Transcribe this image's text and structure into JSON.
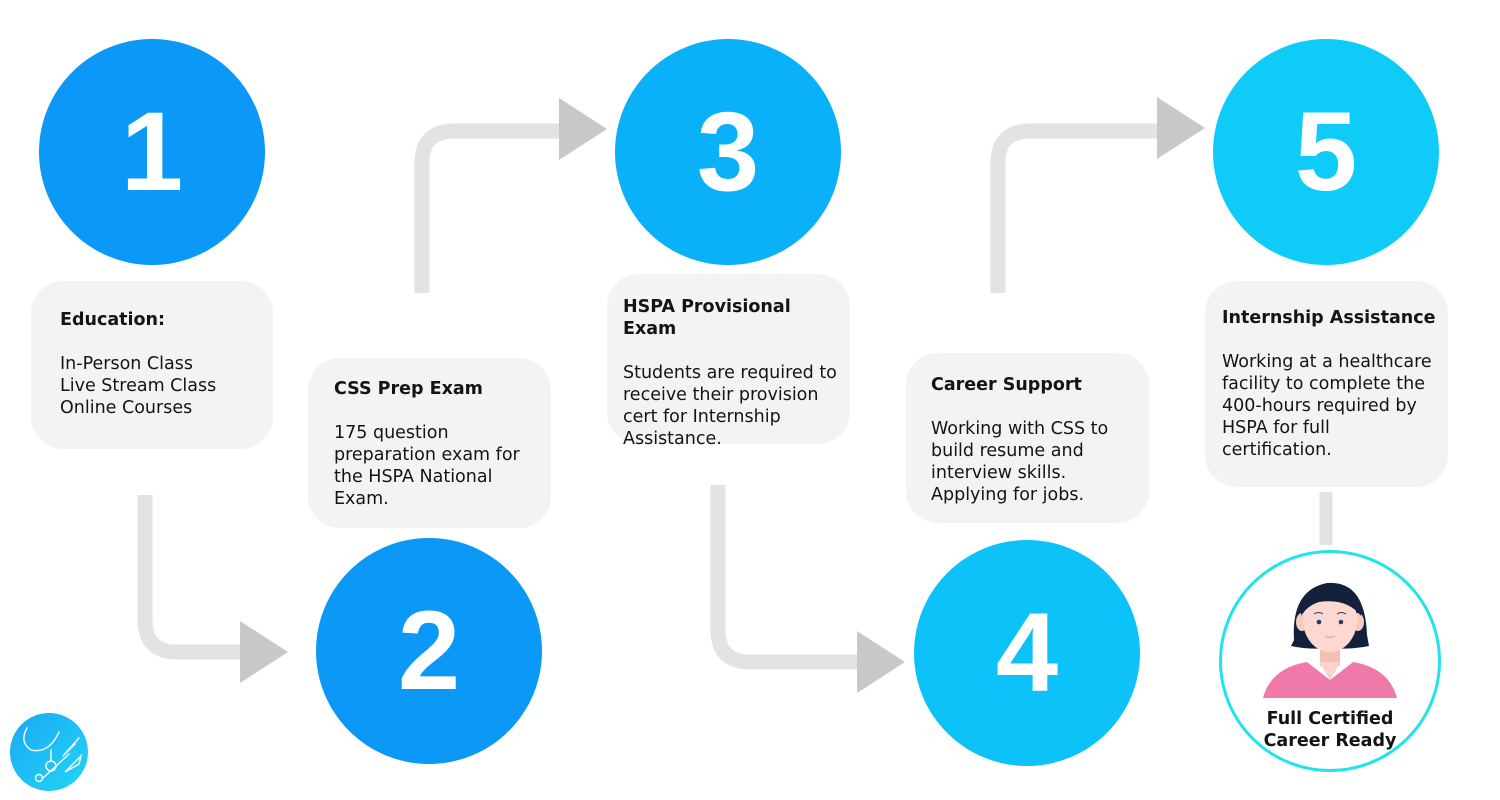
{
  "theme": {
    "circle_colors": [
      "#0b98f7",
      "#0b98f7",
      "#0ab1f9",
      "#0dc2f9",
      "#0fcbf7"
    ],
    "card_background": "#f3f3f3",
    "connector_color": "#e3e3e3",
    "arrowhead_color": "#c8c8c8",
    "final_ring_color": "#22e3ea"
  },
  "steps": [
    {
      "number": "1",
      "title": "Education:",
      "body": "In-Person Class\nLive Stream Class\nOnline Courses"
    },
    {
      "number": "2",
      "title": "CSS Prep Exam",
      "body": "175 question\npreparation exam for\nthe HSPA National\nExam."
    },
    {
      "number": "3",
      "title": "HSPA Provisional Exam",
      "body": "Students are required to\nreceive their provision\ncert for Internship\nAssistance."
    },
    {
      "number": "4",
      "title": "Career Support",
      "body": "Working with CSS to\nbuild resume and\ninterview skills.\nApplying for jobs."
    },
    {
      "number": "5",
      "title": "Internship Assistance",
      "body": "Working at a healthcare\nfacility to complete the\n400-hours required by\nHSPA for full\ncertification."
    }
  ],
  "final": {
    "label": "Full Certified\nCareer Ready",
    "avatar_icon": "nurse-avatar-icon"
  },
  "logo": {
    "icon": "medical-instruments-logo-icon"
  }
}
